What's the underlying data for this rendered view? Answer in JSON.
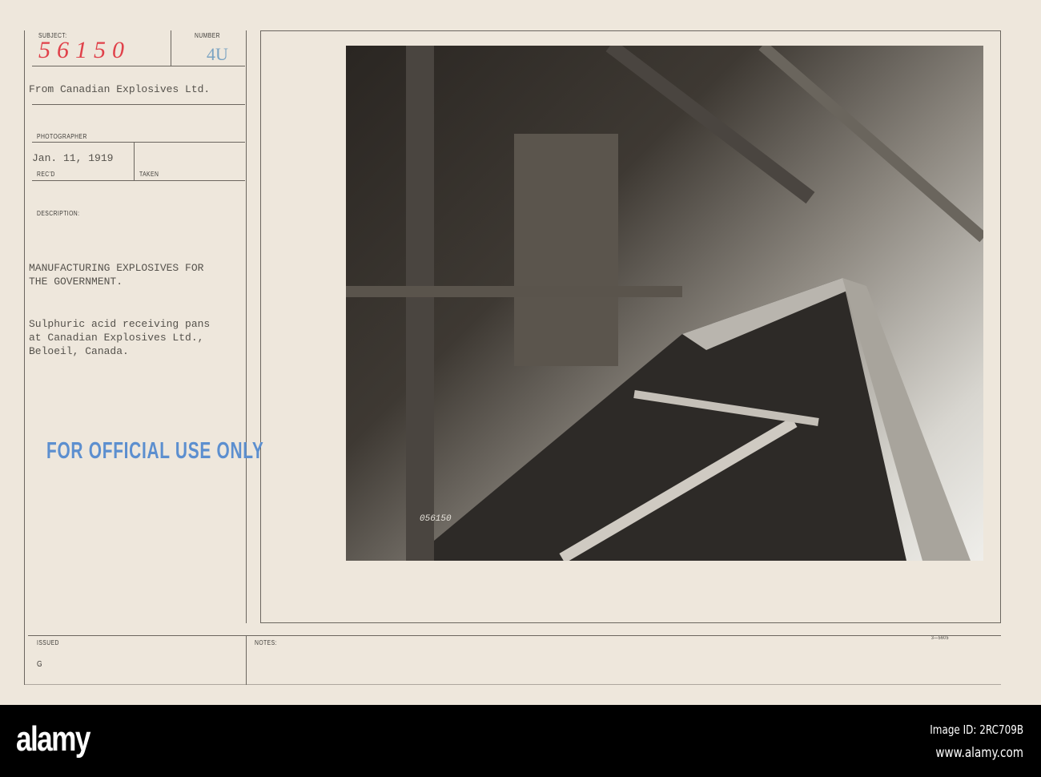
{
  "card": {
    "subject_label": "SUBJECT:",
    "subject_value": "56150",
    "number_label": "NUMBER",
    "number_value": "4U",
    "from": "From Canadian Explosives Ltd.",
    "photographer_label": "PHOTOGRAPHER",
    "received_date": "Jan. 11, 1919",
    "recd_label": "REC'D",
    "taken_label": "TAKEN",
    "description_label": "DESCRIPTION:",
    "description_lines": [
      "MANUFACTURING EXPLOSIVES FOR",
      "THE GOVERNMENT."
    ],
    "caption_lines": [
      "Sulphuric acid receiving pans",
      "at Canadian Explosives Ltd.,",
      "Beloeil, Canada."
    ],
    "stamp": "FOR OFFICIAL USE ONLY",
    "issued_label": "ISSUED",
    "issued_value": "G",
    "notes_label": "NOTES:",
    "form_number": "3—5605",
    "photo_number": "056150"
  },
  "footer": {
    "logo": "alamy",
    "image_id": "Image ID: 2RC709B",
    "url": "www.alamy.com"
  }
}
